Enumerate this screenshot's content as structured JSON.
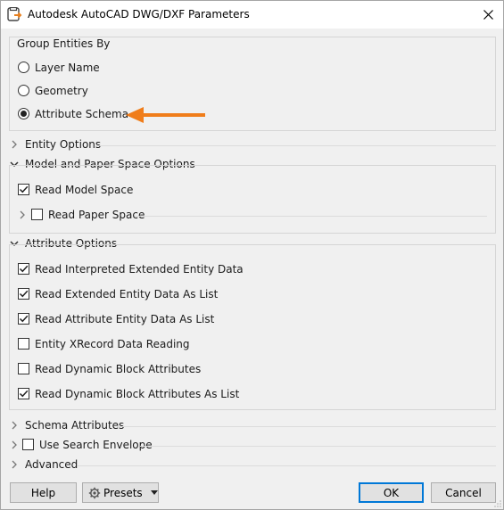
{
  "window": {
    "title": "Autodesk AutoCAD DWG/DXF Parameters"
  },
  "group_entities": {
    "legend": "Group Entities By",
    "options": [
      {
        "label": "Layer Name",
        "selected": false
      },
      {
        "label": "Geometry",
        "selected": false
      },
      {
        "label": "Attribute Schema",
        "selected": true
      }
    ]
  },
  "entity_options": {
    "label": "Entity Options",
    "expanded": false
  },
  "model_paper": {
    "label": "Model and Paper Space Options",
    "expanded": true,
    "read_model_space": {
      "label": "Read Model Space",
      "checked": true
    },
    "read_paper_space": {
      "label": "Read Paper Space",
      "checked": false
    }
  },
  "attribute_options": {
    "label": "Attribute Options",
    "expanded": true,
    "items": [
      {
        "label": "Read Interpreted Extended Entity Data",
        "checked": true
      },
      {
        "label": "Read Extended Entity Data As List",
        "checked": true
      },
      {
        "label": "Read Attribute Entity Data As List",
        "checked": true
      },
      {
        "label": "Entity XRecord Data Reading",
        "checked": false
      },
      {
        "label": "Read Dynamic Block Attributes",
        "checked": false
      },
      {
        "label": "Read Dynamic Block Attributes As List",
        "checked": true
      }
    ]
  },
  "schema_attributes": {
    "label": "Schema Attributes",
    "expanded": false
  },
  "search_envelope": {
    "label": "Use Search Envelope",
    "checked": false
  },
  "advanced": {
    "label": "Advanced",
    "expanded": false
  },
  "footer": {
    "help": "Help",
    "presets": "Presets",
    "ok": "OK",
    "cancel": "Cancel"
  },
  "colors": {
    "arrow": "#f07d1a",
    "default_button_border": "#0078d7"
  },
  "icons": [
    "app-icon",
    "close-icon",
    "chevron-right-icon",
    "chevron-down-icon",
    "gear-icon",
    "dropdown-arrow-icon",
    "annotation-arrow-icon"
  ]
}
